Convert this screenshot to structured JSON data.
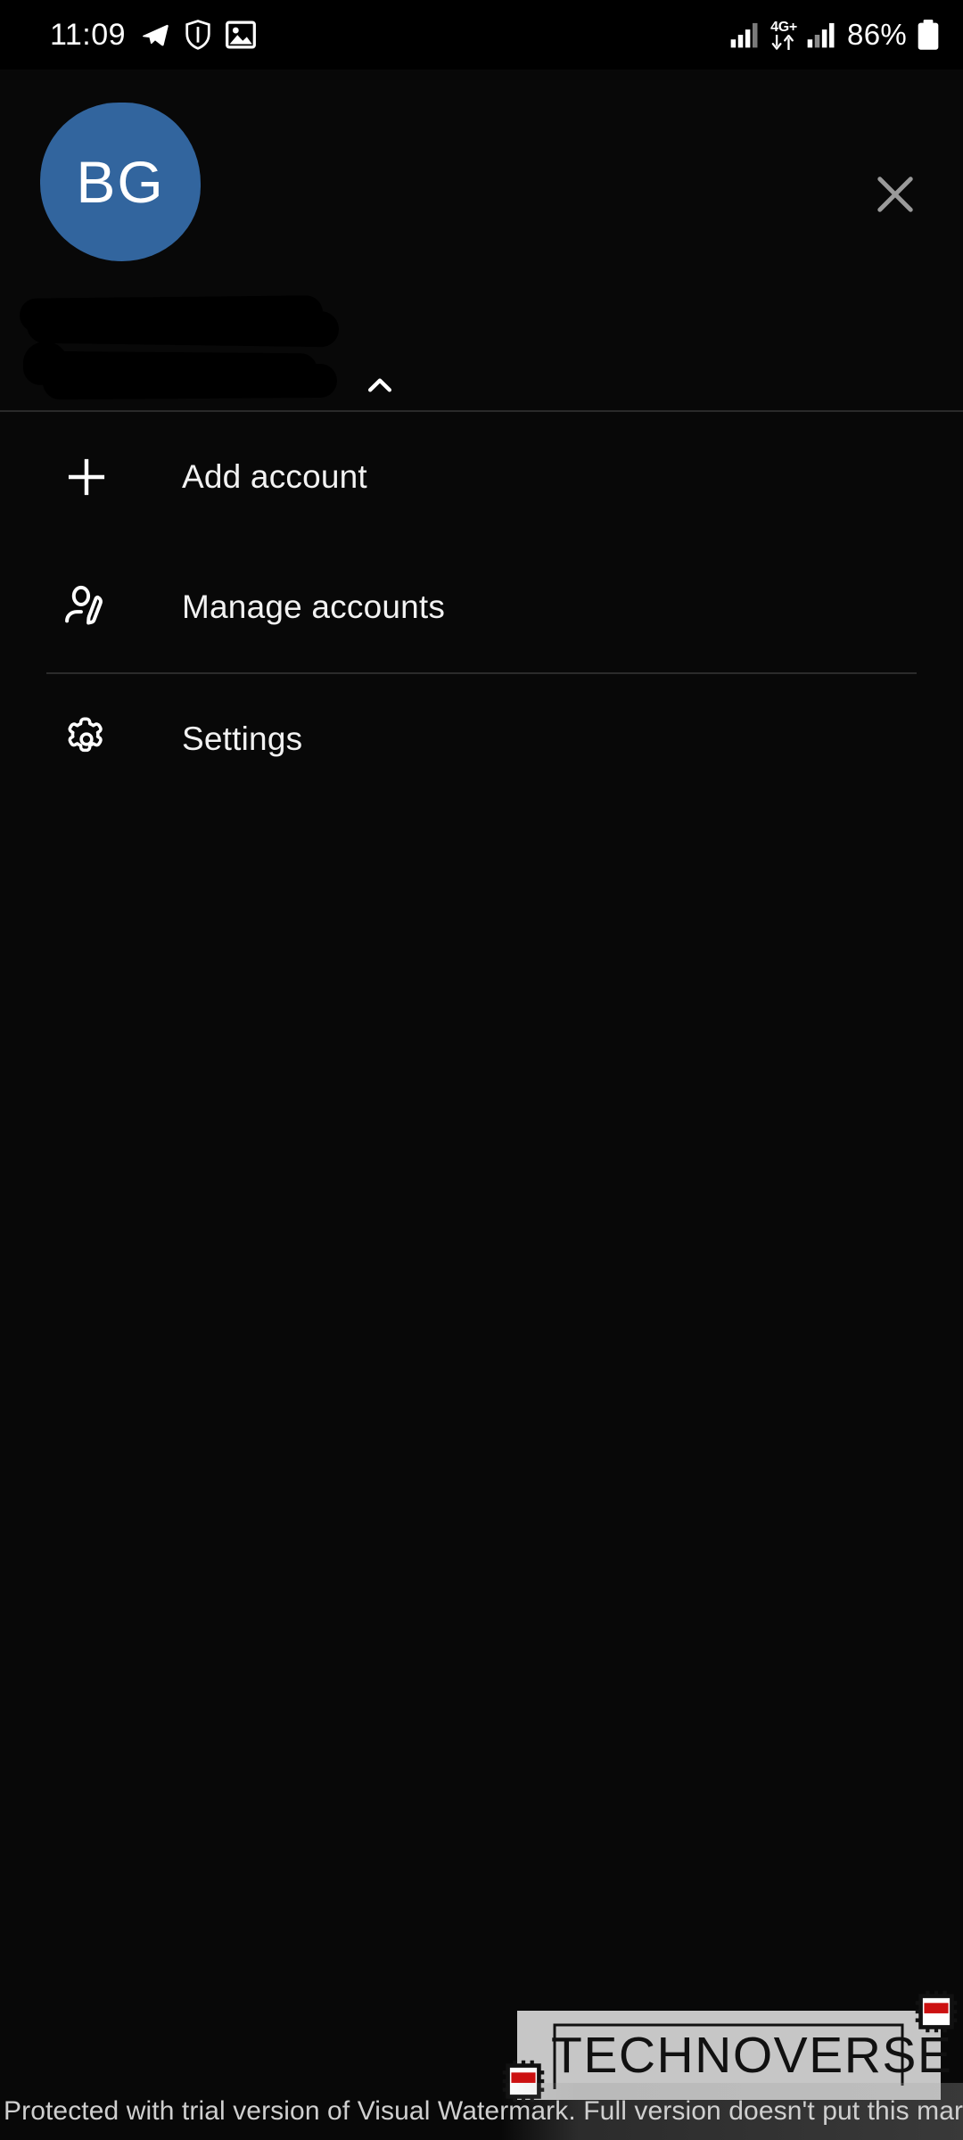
{
  "status_bar": {
    "time": "11:09",
    "battery_percent": "86%",
    "network_type": "4G+",
    "icons": [
      "telegram-icon",
      "shield-vpn-icon",
      "screenshot-image-icon",
      "signal-bars-icon",
      "mobile-data-arrows-icon",
      "signal-bars-2-icon",
      "battery-icon"
    ]
  },
  "header": {
    "avatar_initials": "BG",
    "avatar_color": "#32659E",
    "account_name": "",
    "account_email": "",
    "account_name_redacted": true,
    "account_email_redacted": true,
    "expand_icon": "chevron-up-icon",
    "close_icon": "close-icon"
  },
  "menu": {
    "items": [
      {
        "label": "Add account",
        "icon": "plus-icon"
      },
      {
        "label": "Manage accounts",
        "icon": "person-edit-icon"
      },
      {
        "label": "Settings",
        "icon": "gear-icon"
      }
    ]
  },
  "watermark": {
    "logo_text": "TECHNOVERSE",
    "notice": "Protected with trial version of Visual Watermark. Full version doesn't put this mark",
    "chip_color": "#cc1111",
    "logo_bg": "#c6c6c6"
  }
}
